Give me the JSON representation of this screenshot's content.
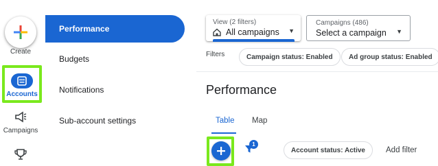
{
  "rail": {
    "create_label": "Create",
    "accounts_label": "Accounts",
    "campaigns_label": "Campaigns"
  },
  "subnav": {
    "items": [
      {
        "label": "Performance",
        "active": true
      },
      {
        "label": "Budgets",
        "active": false
      },
      {
        "label": "Notifications",
        "active": false
      },
      {
        "label": "Sub-account settings",
        "active": false
      }
    ]
  },
  "header": {
    "view_dropdown": {
      "caption": "View (2 filters)",
      "value": "All campaigns"
    },
    "campaigns_dropdown": {
      "caption": "Campaigns (486)",
      "value": "Select a campaign"
    }
  },
  "filters": {
    "label": "Filters",
    "chips": [
      "Campaign status: Enabled",
      "Ad group status: Enabled"
    ]
  },
  "page": {
    "title": "Performance",
    "tabs": [
      {
        "label": "Table",
        "active": true
      },
      {
        "label": "Map",
        "active": false
      }
    ]
  },
  "toolbar": {
    "filter_count": "1",
    "chip": "Account status: Active",
    "add_filter": "Add filter"
  },
  "colors": {
    "accent": "#1a66d2",
    "highlight": "#7ae91d"
  },
  "icons": [
    "create-plus-icon",
    "accounts-icon",
    "campaigns-megaphone-icon",
    "trophy-icon",
    "home-icon",
    "caret-down-icon",
    "plus-icon",
    "filter-icon"
  ]
}
